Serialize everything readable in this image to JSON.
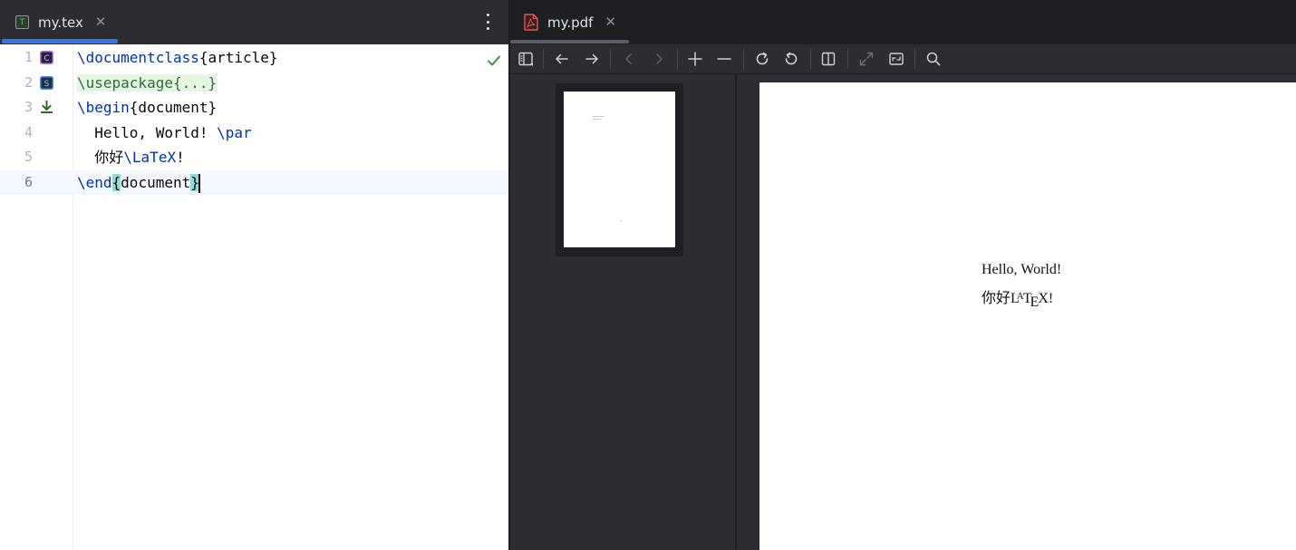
{
  "editor_tab": {
    "icon": "tex-file-icon",
    "icon_letter": "T",
    "label": "my.tex"
  },
  "editor": {
    "lines": [
      {
        "number": "1",
        "gutter_icon": "class-icon",
        "gutter_letter": "C"
      },
      {
        "number": "2",
        "gutter_icon": "style-icon",
        "gutter_letter": "S"
      },
      {
        "number": "3",
        "gutter_icon": "download-icon"
      },
      {
        "number": "4"
      },
      {
        "number": "5"
      },
      {
        "number": "6"
      }
    ],
    "tokens": {
      "l1_cmd": "\\documentclass",
      "l1_arg": "{article}",
      "l2_folded": "\\usepackage{...}",
      "l3_cmd": "\\begin",
      "l3_arg": "{document}",
      "l4_text": "  Hello, World! ",
      "l4_cmd": "\\par",
      "l5_text": "  你好",
      "l5_cmd": "\\LaTeX",
      "l5_tail": "!",
      "l6_cmd": "\\end",
      "l6_open": "{",
      "l6_word": "document",
      "l6_close": "}"
    },
    "status_icon": "check-icon"
  },
  "pdf_tab": {
    "icon": "pdf-file-icon",
    "label": "my.pdf"
  },
  "pdf_toolbar": {
    "buttons": [
      "toggle-sidebar-icon",
      "back-icon",
      "forward-icon",
      "previous-page-icon",
      "next-page-icon",
      "zoom-in-icon",
      "zoom-out-icon",
      "rotate-clockwise-icon",
      "rotate-counterclockwise-icon",
      "split-view-icon",
      "fullscreen-icon",
      "fit-page-icon",
      "search-icon"
    ]
  },
  "pdf_page": {
    "line1": "Hello, World!",
    "line2_cjk": "你好",
    "line2_latex": [
      "L",
      "A",
      "T",
      "E",
      "X"
    ],
    "line2_tail": "!"
  },
  "colors": {
    "accent": "#3574f0",
    "keyword": "#0033b3",
    "check": "#499c54",
    "pdf_icon": "#e05555"
  }
}
